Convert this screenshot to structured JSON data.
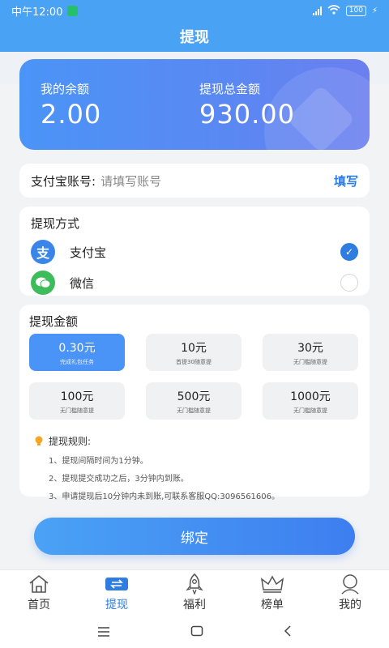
{
  "status_bar": {
    "time": "中午12:00",
    "battery": "100"
  },
  "header": {
    "title": "提现"
  },
  "balance": {
    "my_balance_label": "我的余额",
    "my_balance_value": "2.00",
    "total_label": "提现总金额",
    "total_value": "930.00"
  },
  "account": {
    "label": "支付宝账号:",
    "placeholder": "请填写账号",
    "action": "填写"
  },
  "method": {
    "title": "提现方式",
    "options": [
      {
        "name": "支付宝",
        "icon": "alipay-icon",
        "glyph": "支",
        "selected": true
      },
      {
        "name": "微信",
        "icon": "wechat-icon",
        "selected": false
      }
    ]
  },
  "amount": {
    "title": "提现金额",
    "items": [
      {
        "value": "0.30元",
        "sub": "完成礼包任务",
        "selected": true
      },
      {
        "value": "10元",
        "sub": "首提30随意提",
        "selected": false
      },
      {
        "value": "30元",
        "sub": "无门槛随意提",
        "selected": false
      },
      {
        "value": "100元",
        "sub": "无门槛随意提",
        "selected": false
      },
      {
        "value": "500元",
        "sub": "无门槛随意提",
        "selected": false
      },
      {
        "value": "1000元",
        "sub": "无门槛随意提",
        "selected": false
      }
    ],
    "rules_title": "提现规则:",
    "rules": [
      "1、提现间隔时间为1分钟。",
      "2、提现提交成功之后，3分钟内到账。",
      "3、申请提现后10分钟内未到账,可联系客服QQ:3096561606。"
    ]
  },
  "bind_button": "绑定",
  "tabs": [
    {
      "label": "首页",
      "icon": "home-icon",
      "active": false
    },
    {
      "label": "提现",
      "icon": "withdraw-icon",
      "active": true
    },
    {
      "label": "福利",
      "icon": "rocket-icon",
      "active": false
    },
    {
      "label": "榜单",
      "icon": "crown-icon",
      "active": false
    },
    {
      "label": "我的",
      "icon": "profile-icon",
      "active": false
    }
  ],
  "colors": {
    "primary": "#4aa2f5",
    "accent": "#2f7de1",
    "alipay": "#3a86e8",
    "wechat": "#3cbc5a"
  }
}
